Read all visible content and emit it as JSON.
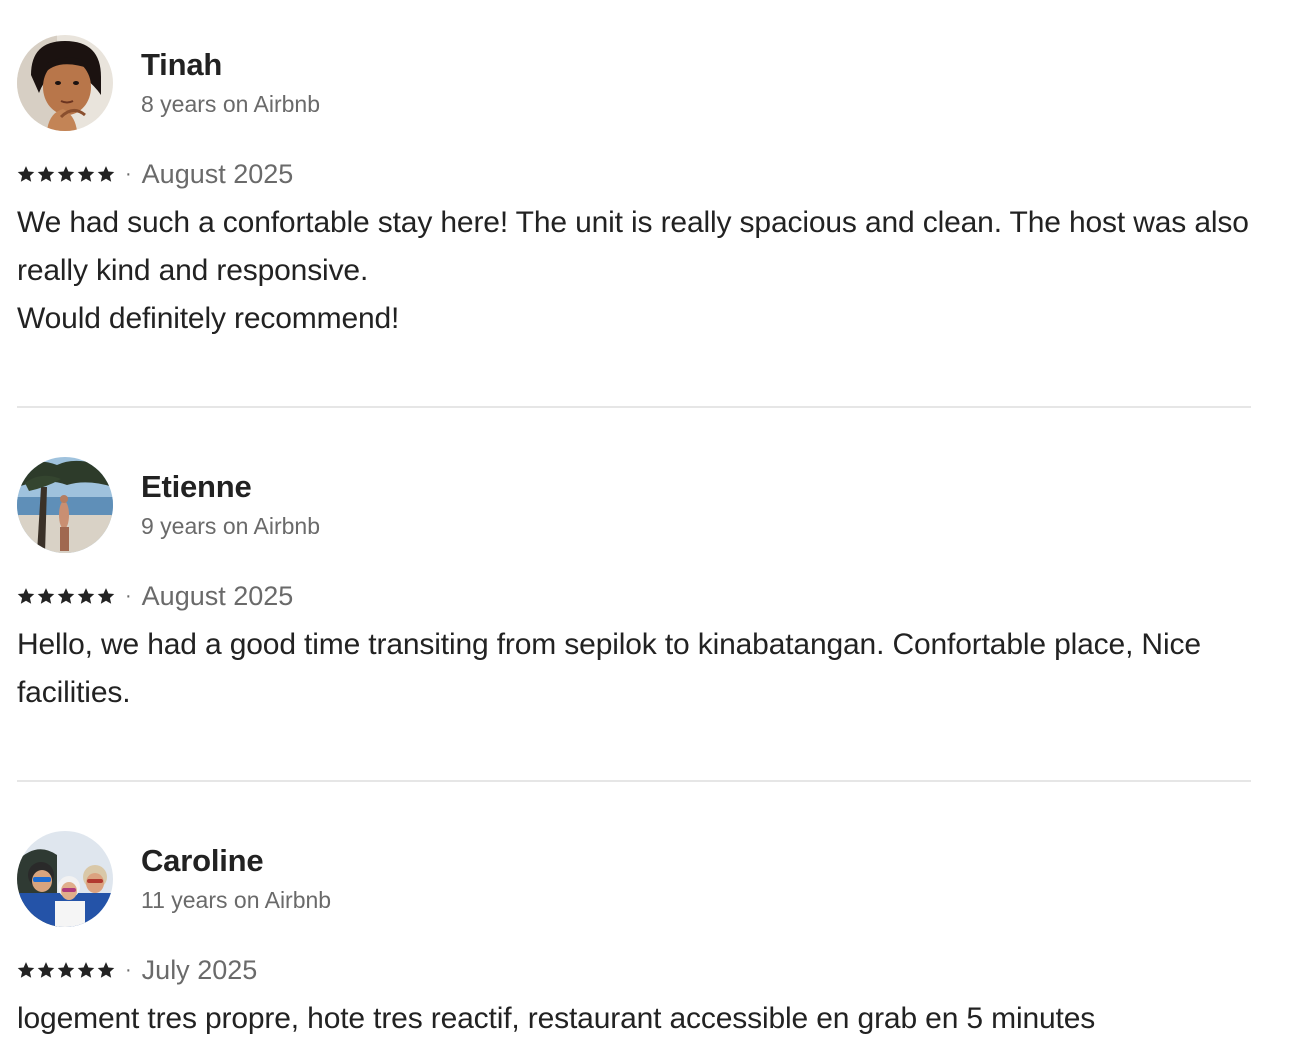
{
  "reviews": [
    {
      "name": "Tinah",
      "tenure": "8 years on Airbnb",
      "rating": 5,
      "date": "August 2025",
      "text": "We had such a confortable stay here! The unit is really spacious and clean. The host was also really kind and responsive.\nWould definitely recommend!"
    },
    {
      "name": "Etienne",
      "tenure": "9 years on Airbnb",
      "rating": 5,
      "date": "August 2025",
      "text": "Hello, we had a good time transiting from sepilok to kinabatangan. Confortable place, Nice facilities."
    },
    {
      "name": "Caroline",
      "tenure": "11 years on Airbnb",
      "rating": 5,
      "date": "July 2025",
      "text": "logement tres propre, hote tres reactif, restaurant accessible en grab en 5 minutes"
    }
  ],
  "separator": "·",
  "icons": {
    "star": "star-icon"
  },
  "colors": {
    "text": "#222222",
    "secondary": "#6a6a6a",
    "divider": "#e6e6e6"
  }
}
